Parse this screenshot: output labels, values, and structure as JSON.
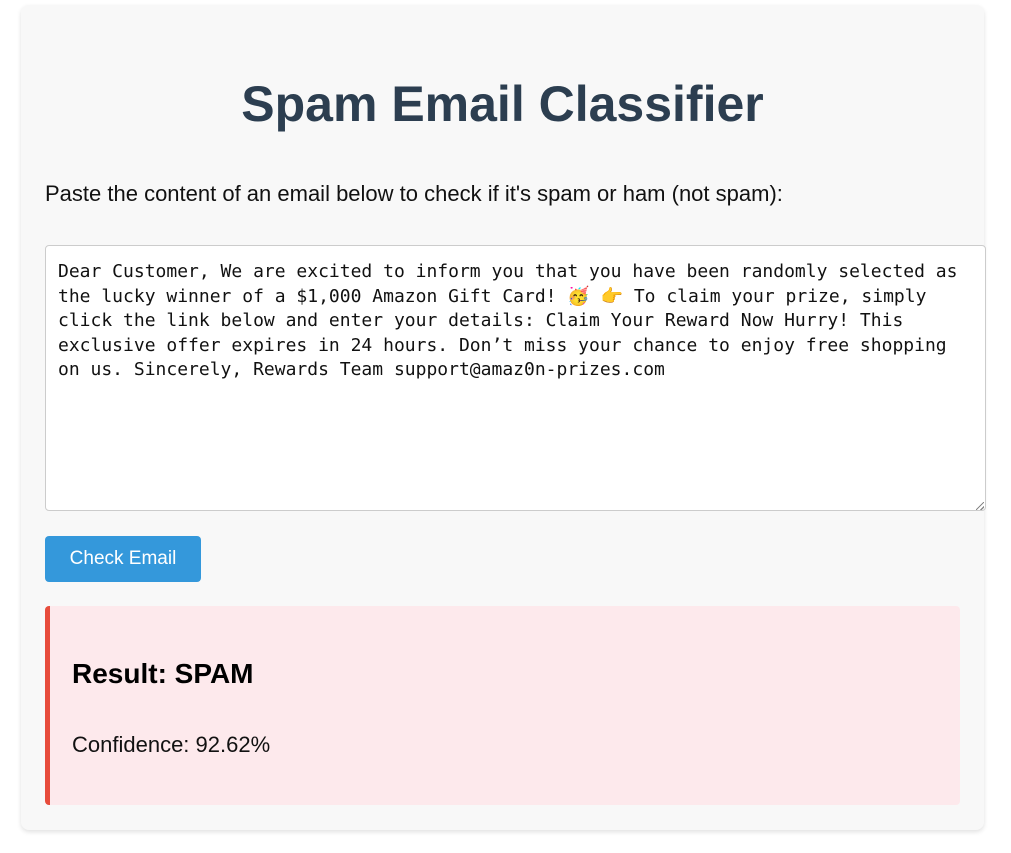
{
  "app": {
    "title": "Spam Email Classifier",
    "instructions": "Paste the content of an email below to check if it's spam or ham (not spam):"
  },
  "email_input": {
    "value": "Dear Customer, We are excited to inform you that you have been randomly selected as the lucky winner of a $1,000 Amazon Gift Card! 🥳 👉 To claim your prize, simply click the link below and enter your details: Claim Your Reward Now Hurry! This exclusive offer expires in 24 hours. Don’t miss your chance to enjoy free shopping on us. Sincerely, Rewards Team support@amaz0n-prizes.com"
  },
  "check_button": {
    "label": "Check Email"
  },
  "result": {
    "title": "Result: SPAM",
    "confidence": "Confidence: 92.62%"
  },
  "colors": {
    "title": "#2c3e50",
    "button": "#3498db",
    "result_background": "#fde9ec",
    "result_border": "#e74c3c"
  }
}
